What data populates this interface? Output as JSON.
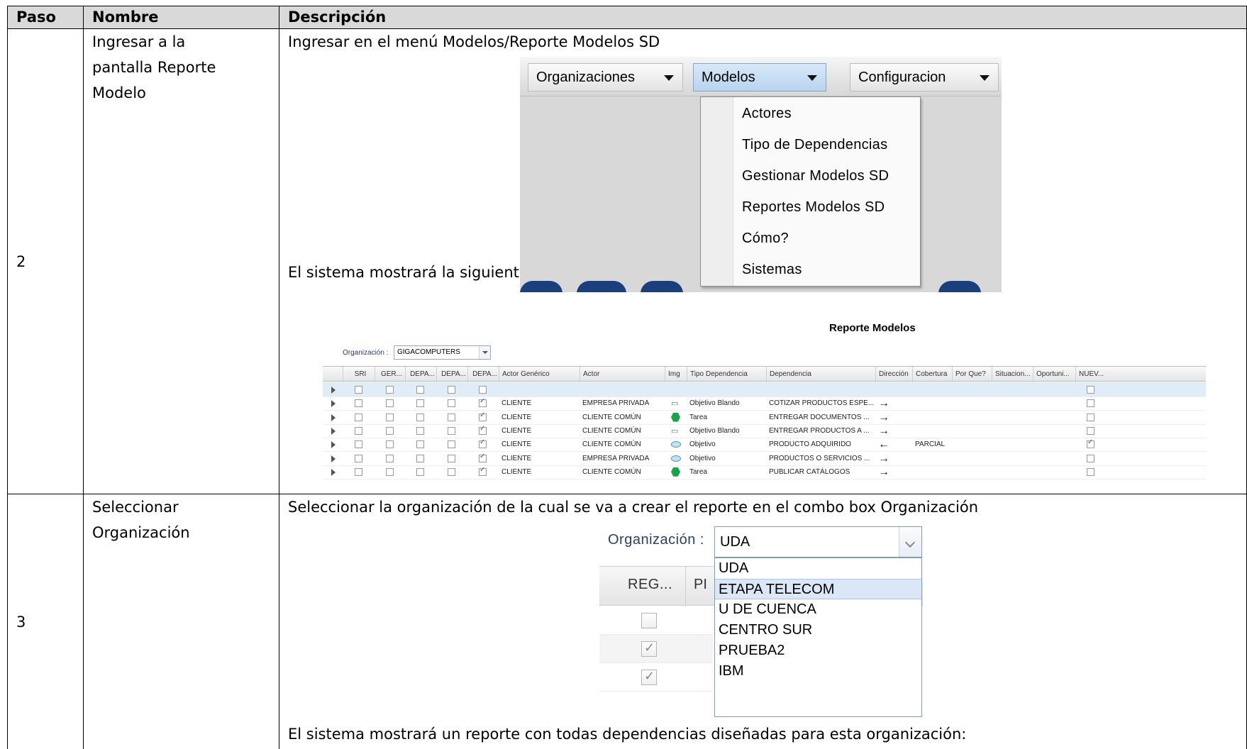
{
  "table": {
    "headers": {
      "paso": "Paso",
      "nombre": "Nombre",
      "descripcion": "Descripción"
    },
    "rows": [
      {
        "paso": "2",
        "nombre": "Ingresar a la pantalla Reporte Modelo",
        "desc_1": "Ingresar en el menú Modelos/Reporte Modelos SD",
        "desc_2": "El sistema mostrará la siguiente pantalla:"
      },
      {
        "paso": "3",
        "nombre": "Seleccionar Organización",
        "desc_1": "Seleccionar la organización de la cual se va a crear el reporte en el combo box Organización",
        "desc_2": "El sistema mostrará un reporte con todas dependencias diseñadas para esta organización:"
      }
    ]
  },
  "menu_screenshot": {
    "menus": [
      "Organizaciones",
      "Modelos",
      "Configuracion"
    ],
    "active_menu": "Modelos",
    "items": [
      "Actores",
      "Tipo de Dependencias",
      "Gestionar Modelos SD",
      "Reportes Modelos SD",
      "Cómo?",
      "Sistemas"
    ]
  },
  "report_screenshot": {
    "title": "Reporte Modelos",
    "org_label": "Organización :",
    "org_value": "GIGACOMPUTERS",
    "columns": [
      "SRI",
      "GER...",
      "DEPA...",
      "DEPA...",
      "DEPA...",
      "Actor Genérico",
      "Actor",
      "Img",
      "Tipo Dependencia",
      "Dependencia",
      "Dirección",
      "Cobertura",
      "Por Que?",
      "Situacion...",
      "Oportuni...",
      "NUEV..."
    ],
    "rows": [
      {
        "checks": [
          false,
          false,
          false,
          false,
          false
        ],
        "actor_generico": "",
        "actor": "",
        "img": "",
        "tipo": "",
        "dependencia": "",
        "direccion": "",
        "cobertura": "",
        "nuevo": false,
        "selected": true
      },
      {
        "checks": [
          false,
          false,
          false,
          false,
          true
        ],
        "actor_generico": "CLIENTE",
        "actor": "EMPRESA PRIVADA",
        "img": "cloud",
        "tipo": "Objetivo Blando",
        "dependencia": "COTIZAR PRODUCTOS ESPE...",
        "direccion": "→",
        "cobertura": "",
        "nuevo": false
      },
      {
        "checks": [
          false,
          false,
          false,
          false,
          true
        ],
        "actor_generico": "CLIENTE",
        "actor": "CLIENTE COMÚN",
        "img": "hexagon",
        "tipo": "Tarea",
        "dependencia": "ENTREGAR DOCUMENTOS ...",
        "direccion": "→",
        "cobertura": "",
        "nuevo": false
      },
      {
        "checks": [
          false,
          false,
          false,
          false,
          true
        ],
        "actor_generico": "CLIENTE",
        "actor": "CLIENTE COMÚN",
        "img": "cloud",
        "tipo": "Objetivo Blando",
        "dependencia": "ENTREGAR PRODUCTOS A ...",
        "direccion": "→",
        "cobertura": "",
        "nuevo": false
      },
      {
        "checks": [
          false,
          false,
          false,
          false,
          true
        ],
        "actor_generico": "CLIENTE",
        "actor": "CLIENTE COMÚN",
        "img": "oval",
        "tipo": "Objetivo",
        "dependencia": "PRODUCTO ADQUIRIDO",
        "direccion": "←",
        "cobertura": "PARCIAL",
        "nuevo": true
      },
      {
        "checks": [
          false,
          false,
          false,
          false,
          true
        ],
        "actor_generico": "CLIENTE",
        "actor": "EMPRESA PRIVADA",
        "img": "oval",
        "tipo": "Objetivo",
        "dependencia": "PRODUCTOS O SERVICIOS ...",
        "direccion": "→",
        "cobertura": "",
        "nuevo": false
      },
      {
        "checks": [
          false,
          false,
          false,
          false,
          true
        ],
        "actor_generico": "CLIENTE",
        "actor": "CLIENTE COMÚN",
        "img": "hexagon",
        "tipo": "Tarea",
        "dependencia": "PUBLICAR CATÁLOGOS",
        "direccion": "→",
        "cobertura": "",
        "nuevo": false
      }
    ]
  },
  "combo_screenshot": {
    "label": "Organización :",
    "value": "UDA",
    "column_header": "REG...",
    "column_peek": "PI",
    "options": [
      "UDA",
      "ETAPA TELECOM",
      "U DE CUENCA",
      "CENTRO SUR",
      "PRUEBA2",
      "IBM"
    ],
    "hovered_option": "ETAPA TELECOM",
    "row_checks": [
      false,
      true,
      true
    ]
  }
}
